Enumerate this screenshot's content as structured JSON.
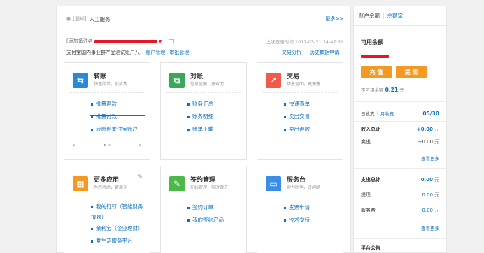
{
  "notice": {
    "tag": "[通知]",
    "text": "人工服务",
    "more": "更多>>"
  },
  "account": {
    "add_note": "[添加备注名",
    "last_login": "上次登录时间 2017-05-31 14:47:51",
    "name": "支付宝国内事业群产品测试账户八",
    "links": [
      "账户管理",
      "审批管理"
    ],
    "right_links": [
      "交易分析",
      "历史数据申请"
    ]
  },
  "cards": [
    {
      "title": "转账",
      "subtitle": "快速简单，低成本",
      "icon": "transfer-arrows-icon",
      "color": "#2a8ad8",
      "items": [
        "批量退款",
        "批量付款",
        "转账到支付宝账户"
      ]
    },
    {
      "title": "对账",
      "subtitle": "信息全面，更省力",
      "icon": "reconcile-icon",
      "color": "#3aa85a",
      "items": [
        "账务汇总",
        "账务明细",
        "账单下载"
      ]
    },
    {
      "title": "交易",
      "subtitle": "场景全面，更便捷",
      "icon": "trend-chart-icon",
      "color": "#f05a4a",
      "items": [
        "快速查单",
        "卖出交易",
        "卖出退款"
      ]
    },
    {
      "title": "更多应用",
      "subtitle": "为您考虑，更周全",
      "icon": "grid-apps-icon",
      "color": "#f39a22",
      "items": [
        "我的钉钉（智能财务报表）",
        "余利宝（企业理财）",
        "爱生活服务平台"
      ]
    },
    {
      "title": "签约管理",
      "subtitle": "在线管理，实时跟进",
      "icon": "sign-pen-icon",
      "color": "#4cb848",
      "items": [
        "签约订单",
        "我的签约产品"
      ]
    },
    {
      "title": "服务台",
      "subtitle": "得力助手，泛问题",
      "icon": "window-service-icon",
      "color": "#3a8ee6",
      "items": [
        "发票申请",
        "技术支持"
      ]
    }
  ],
  "sidebar": {
    "tabs": [
      "账户余额",
      "余额宝"
    ],
    "available_title": "可用余额",
    "recharge": "充 值",
    "withdraw": "提 现",
    "frozen_label": "不可用余额",
    "frozen_value": "0.21",
    "unit": "元",
    "period_tabs": [
      "日收支",
      "月收支"
    ],
    "date": "05/30",
    "income_total_label": "收入总计",
    "income_total": "+0.00",
    "sell_label": "卖出",
    "sell_value": "+0.00",
    "more": "查看更多",
    "expense_total_label": "支出总计",
    "expense_total": "0.00",
    "withdraw_label": "提现",
    "withdraw_value": "0.00",
    "fee_label": "服务费",
    "fee_value": "0.00",
    "announcement": "平台公告"
  }
}
